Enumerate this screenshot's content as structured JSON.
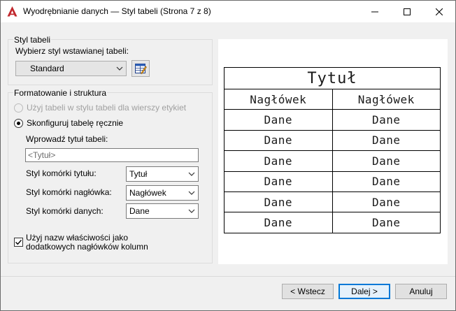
{
  "window": {
    "title": "Wyodrębnianie danych — Styl tabeli (Strona 7 z 8)",
    "accent_color": "#c1272d"
  },
  "table_style": {
    "group_label": "Styl tabeli",
    "select_label": "Wybierz styl wstawianej tabeli:",
    "selected_style": "Standard"
  },
  "formatting": {
    "group_label": "Formatowanie i struktura",
    "radio_use_table_style": "Użyj tabeli w stylu tabeli dla wierszy etykiet",
    "radio_manual": "Skonfiguruj tabelę ręcznie",
    "title_prompt": "Wprowadź tytuł tabeli:",
    "title_placeholder": "<Tytuł>",
    "title_cell_style_label": "Styl komórki tytułu:",
    "title_cell_style_value": "Tytuł",
    "header_cell_style_label": "Styl komórki nagłówka:",
    "header_cell_style_value": "Nagłówek",
    "data_cell_style_label": "Styl komórki danych:",
    "data_cell_style_value": "Dane",
    "use_property_names_line1": "Użyj nazw właściwości jako",
    "use_property_names_line2": "dodatkowych nagłówków kolumn",
    "use_property_names_checked": true
  },
  "preview": {
    "title": "Tytuł",
    "headers": [
      "Nagłówek",
      "Nagłówek"
    ],
    "rows": [
      [
        "Dane",
        "Dane"
      ],
      [
        "Dane",
        "Dane"
      ],
      [
        "Dane",
        "Dane"
      ],
      [
        "Dane",
        "Dane"
      ],
      [
        "Dane",
        "Dane"
      ],
      [
        "Dane",
        "Dane"
      ]
    ]
  },
  "buttons": {
    "back": "< Wstecz",
    "next": "Dalej >",
    "cancel": "Anuluj"
  }
}
